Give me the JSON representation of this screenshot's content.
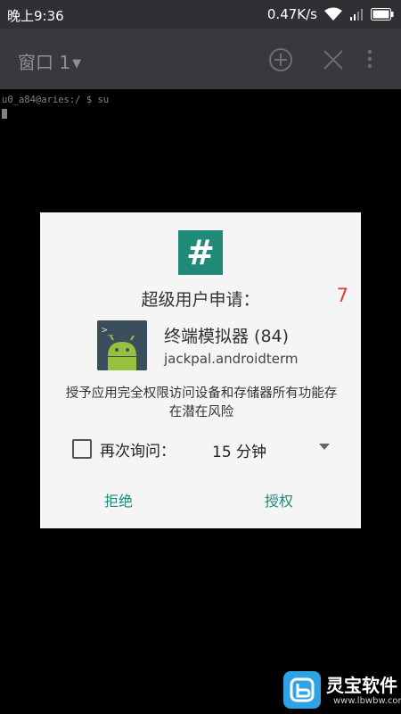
{
  "status_bar": {
    "time": "晚上9:36",
    "net_speed": "0.47K/s",
    "icons": [
      "wifi-icon",
      "signal-icon",
      "battery-icon"
    ]
  },
  "toolbar": {
    "window_title": "窗口 1",
    "icons": [
      "add-window-icon",
      "close-window-icon",
      "overflow-menu-icon"
    ]
  },
  "terminal": {
    "prompt_line": "u0_a84@aries:/ $ su"
  },
  "dialog": {
    "logo_glyph": "#",
    "request_title": "超级用户申请：",
    "countdown": "7",
    "app_name": "终端模拟器 (84)",
    "app_package": "jackpal.androidterm",
    "warning": "授予应用完全权限访问设备和存储器所有功能存在潜在风险",
    "ask_again_label": "再次询问：",
    "ask_again_checked": false,
    "duration_selected": "15 分钟",
    "deny_label": "拒绝",
    "grant_label": "授权",
    "accent_color": "#1f8a77",
    "countdown_color": "#e53935"
  },
  "watermark": {
    "name": "灵宝软件",
    "url": "www.lbwbw.com"
  }
}
